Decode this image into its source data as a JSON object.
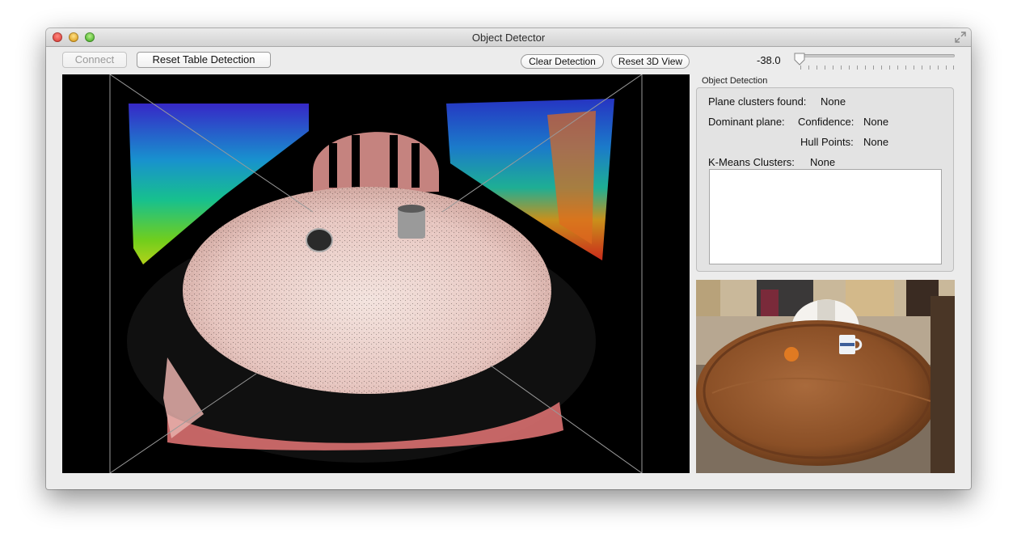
{
  "window": {
    "title": "Object Detector"
  },
  "toolbar": {
    "connect_label": "Connect",
    "reset_table_label": "Reset Table Detection",
    "clear_detection_label": "Clear Detection",
    "reset_3d_label": "Reset 3D View",
    "slider_value": "-38.0",
    "slider_fraction": 0.0
  },
  "panel": {
    "title": "Object Detection",
    "plane_clusters_label": "Plane clusters found:",
    "plane_clusters_value": "None",
    "dominant_plane_label": "Dominant plane:",
    "confidence_label": "Confidence:",
    "confidence_value": "None",
    "hull_points_label": "Hull Points:",
    "hull_points_value": "None",
    "kmeans_label": "K-Means Clusters:",
    "kmeans_value": "None"
  },
  "colors": {
    "window_bg": "#ececec",
    "viewport_bg": "#000000",
    "point_cloud_table": "#e8c8c2",
    "point_cloud_edges": "#d97070"
  },
  "icons": {
    "close": "close-icon",
    "minimize": "minimize-icon",
    "zoom": "zoom-icon",
    "fullscreen": "fullscreen-icon"
  }
}
